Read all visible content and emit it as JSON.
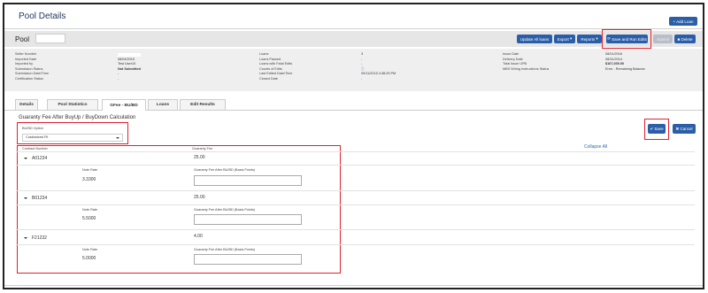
{
  "page_title": "Pool Details",
  "add_loan": "+ Add Loan",
  "pool": {
    "label": "Pool",
    "value": ""
  },
  "toolbar": {
    "update_all": "Update All loans",
    "export": "Export",
    "reports": "Reports",
    "save_run": "Save and Run Edits",
    "submit": "Submit",
    "delete": "Delete"
  },
  "info": {
    "left_labels": [
      "Seller Number",
      "Imported Date",
      "Imported by",
      "Submission Status",
      "Submission Date/Time",
      "Certification Status"
    ],
    "left_values": [
      "",
      "08/04/2015",
      "Test User10",
      "Not Submitted",
      "-",
      "-"
    ],
    "mid_labels": [
      "Loans",
      "Loans Passed",
      "Loans with Fatal Edits",
      "Counts of Edits",
      "Last Edited Date/Time",
      "Closed Date"
    ],
    "mid_values": [
      "3",
      "-",
      "-",
      "",
      "09/11/2015 4:38:25 PM",
      "-"
    ],
    "right_labels": [
      "Issue Date",
      "Delivery Date",
      "Total Issue UPB",
      "MBS Wiring Instructions Status"
    ],
    "right_values": [
      "08/01/2016",
      "08/31/2014",
      "$167,000.00",
      "Error - Remaining Balance"
    ]
  },
  "tabs": [
    "Details",
    "Pool Statistics",
    "GFee - BU/BD",
    "Loans",
    "Edit Results"
  ],
  "section_title": "Guaranty Fee After BuyUp / BuyDown Calculation",
  "option": {
    "label": "BU/BD Option",
    "value": "Customized Fit"
  },
  "actions": {
    "save": "Save",
    "cancel": "Cancel",
    "collapse_all": "Collapse All"
  },
  "table": {
    "col_contract": "Contract Number",
    "col_fee": "Guaranty Fee",
    "note_rate_label": "Note Rate",
    "fee_after_label": "Guaranty Fee After BU/BD (Basis Points)",
    "rows": [
      {
        "contract": "A01234",
        "fee": "25.00",
        "note_rate": "3.3300"
      },
      {
        "contract": "B01234",
        "fee": "25.00",
        "note_rate": "5.5000"
      },
      {
        "contract": "F21232",
        "fee": "4.00",
        "note_rate": "5.0000"
      }
    ]
  },
  "colors": {
    "primary": "#2b5ea8",
    "highlight": "#e2212f",
    "link": "#2b6cb0"
  },
  "icons": [
    "caret-down-icon",
    "refresh-icon",
    "check-icon",
    "x-icon",
    "trash-icon",
    "info-icon"
  ]
}
